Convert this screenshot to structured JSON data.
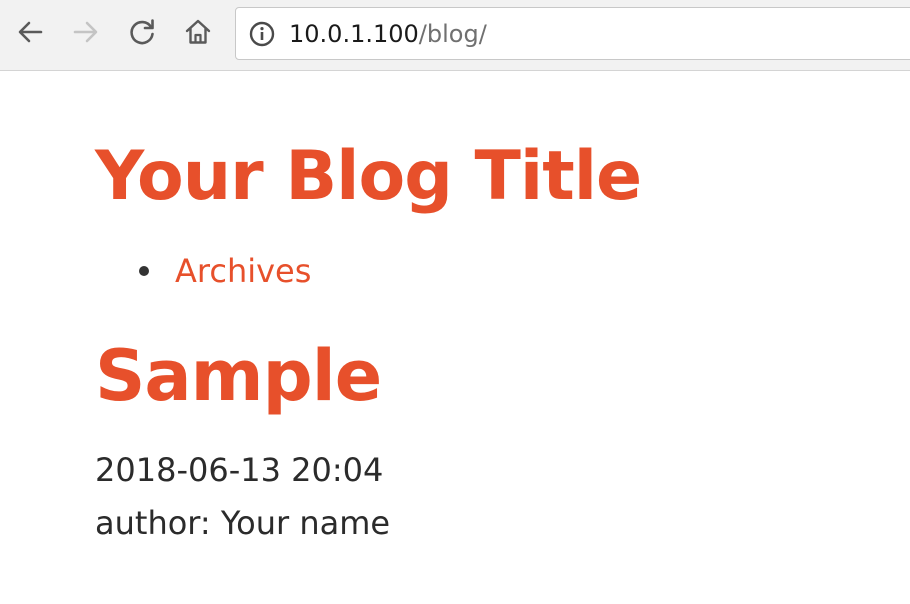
{
  "browser": {
    "url_host": "10.0.1.100",
    "url_path": "/blog/",
    "icons": {
      "back": "back-arrow-icon",
      "forward": "forward-arrow-icon",
      "reload": "reload-icon",
      "home": "home-icon",
      "site_info": "info-icon"
    },
    "forward_enabled": false
  },
  "page": {
    "site_title": "Your Blog Title",
    "nav": [
      {
        "label": "Archives"
      }
    ],
    "post": {
      "title": "Sample",
      "date": "2018-06-13 20:04",
      "author": "author: Your name"
    }
  },
  "colors": {
    "accent": "#e7502b",
    "body_text": "#2b2b2b",
    "toolbar_bg": "#f2f2f2"
  }
}
